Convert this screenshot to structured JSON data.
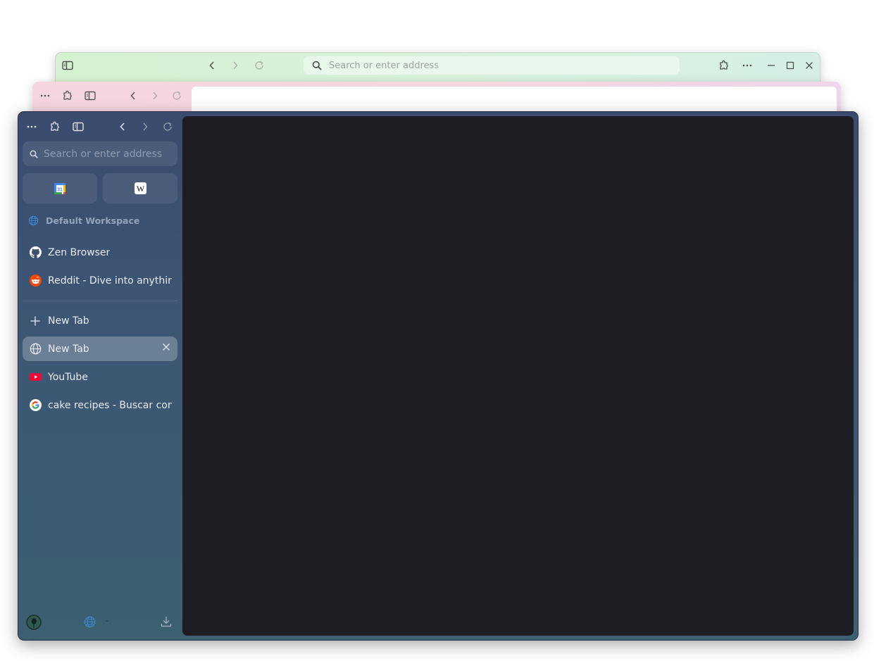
{
  "windows": {
    "back": {
      "theme_color": "#d7f0d6",
      "toolbar": {
        "sidebar_toggle_icon": "sidebar-icon",
        "back_icon": "chevron-left-icon",
        "forward_icon": "chevron-right-icon",
        "reload_icon": "reload-icon",
        "search_placeholder": "Search or enter address",
        "extensions_icon": "puzzle-icon",
        "menu_icon": "more-horizontal-icon",
        "window_controls": [
          "minimize",
          "maximize",
          "close"
        ]
      }
    },
    "middle": {
      "theme_color": "#f6d6de",
      "toolbar": {
        "menu_icon": "more-horizontal-icon",
        "extensions_icon": "puzzle-icon",
        "sidebar_toggle_icon": "sidebar-icon",
        "back_icon": "chevron-left-icon",
        "forward_icon": "chevron-right-icon",
        "reload_icon": "reload-icon"
      }
    },
    "front": {
      "theme_color": "#3d5674",
      "content_color": "#1e1d23",
      "toolbar": {
        "menu_icon": "more-horizontal-icon",
        "extensions_icon": "puzzle-icon",
        "sidebar_toggle_icon": "sidebar-icon",
        "back_icon": "chevron-left-icon",
        "forward_icon": "chevron-right-icon",
        "reload_icon": "reload-icon"
      },
      "search": {
        "placeholder": "Search or enter address"
      },
      "pinned": [
        {
          "name": "Google Calendar",
          "icon": "calendar-icon",
          "badge": "31"
        },
        {
          "name": "Wikipedia",
          "icon": "wikipedia-icon",
          "badge": "W"
        }
      ],
      "workspace": {
        "label": "Default Workspace",
        "icon": "globe-icon"
      },
      "essential_tabs": [
        {
          "title": "Zen Browser",
          "icon": "github-icon"
        },
        {
          "title": "Reddit - Dive into anything",
          "icon": "reddit-icon"
        }
      ],
      "new_tab_button": {
        "label": "New Tab",
        "icon": "plus-icon"
      },
      "tabs": [
        {
          "title": "New Tab",
          "icon": "globe-icon",
          "active": true
        },
        {
          "title": "YouTube",
          "icon": "youtube-icon",
          "active": false
        },
        {
          "title": "cake recipes - Buscar con Google",
          "icon": "google-icon",
          "active": false
        }
      ],
      "bottom_bar": {
        "profile_icon": "avatar",
        "workspace_icon": "globe-icon",
        "workspace_indicator": "-",
        "downloads_icon": "download-icon"
      }
    }
  }
}
